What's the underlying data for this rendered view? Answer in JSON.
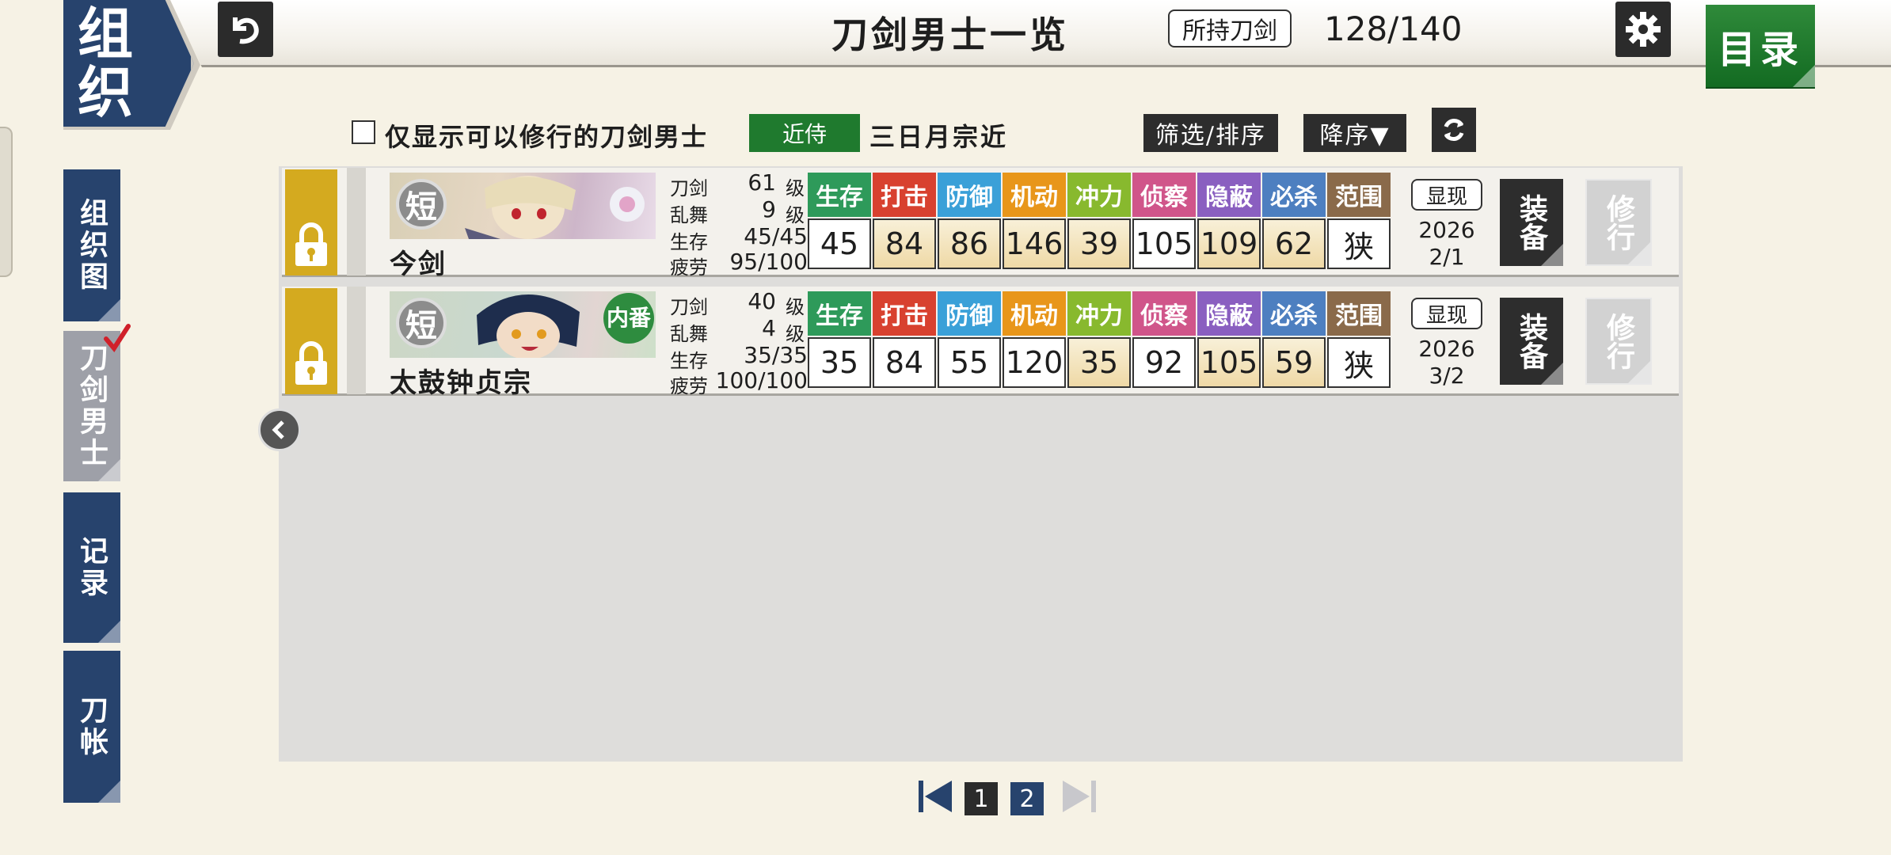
{
  "header": {
    "badge_line1": "组",
    "badge_line2": "织",
    "title": "刀剑男士一览",
    "owned_label": "所持刀剑",
    "owned_count": "128/140",
    "menu_label": "目录"
  },
  "sidebar": {
    "items": [
      {
        "label": "组织图"
      },
      {
        "label": "刀剑男士",
        "active": true
      },
      {
        "label": "记录"
      },
      {
        "label": "刀帐"
      }
    ]
  },
  "filters": {
    "checkbox_label": "仅显示可以修行的刀剑男士",
    "checkbox_checked": false,
    "near_badge": "近侍",
    "near_name": "三日月宗近",
    "filter_sort": "筛选/排序",
    "order": "降序▼"
  },
  "stat_headers": [
    "生存",
    "打击",
    "防御",
    "机动",
    "冲力",
    "侦察",
    "隐蔽",
    "必杀",
    "范围"
  ],
  "stat_colors": [
    "#2e9a5a",
    "#d8412f",
    "#3aa0d8",
    "#e8961a",
    "#88b92e",
    "#d0558a",
    "#8a5fc0",
    "#4d7fc0",
    "#8a6a4a"
  ],
  "mini_labels": {
    "sword": "刀剑",
    "dance": "乱舞",
    "hp": "生存",
    "fatigue": "疲劳",
    "level_unit": "级"
  },
  "rows": [
    {
      "name": "今剑",
      "type_badge": "短",
      "sword_level": "61",
      "dance_level": "9",
      "hp": "45/45",
      "fatigue": "95/100",
      "stats": [
        "45",
        "84",
        "86",
        "146",
        "39",
        "105",
        "109",
        "62",
        "狭"
      ],
      "highlight": [
        false,
        true,
        true,
        true,
        true,
        false,
        true,
        true,
        false
      ],
      "appear_label": "显现",
      "appear_year": "2026",
      "appear_date": "2/1",
      "equip_label": "装备",
      "train_label": "修行",
      "tag": ""
    },
    {
      "name": "太鼓钟贞宗",
      "type_badge": "短",
      "sword_level": "40",
      "dance_level": "4",
      "hp": "35/35",
      "fatigue": "100/100",
      "stats": [
        "35",
        "84",
        "55",
        "120",
        "35",
        "92",
        "105",
        "59",
        "狭"
      ],
      "highlight": [
        false,
        false,
        false,
        false,
        true,
        false,
        true,
        true,
        false
      ],
      "appear_label": "显现",
      "appear_year": "2026",
      "appear_date": "3/2",
      "equip_label": "装备",
      "train_label": "修行",
      "tag": "内番"
    }
  ],
  "pagination": {
    "pages": [
      "1",
      "2"
    ],
    "current": "2"
  }
}
